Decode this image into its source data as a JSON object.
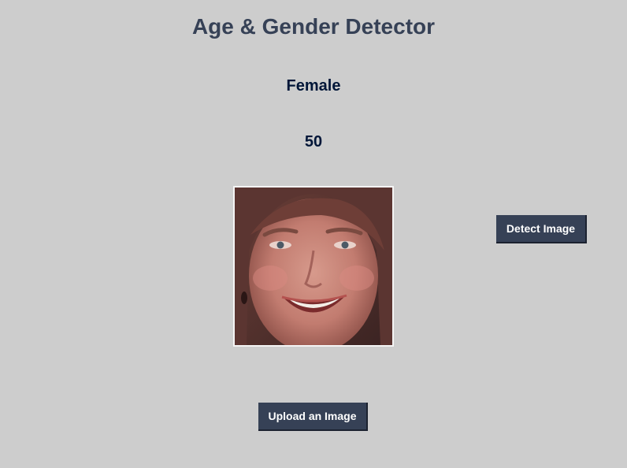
{
  "app": {
    "title": "Age & Gender Detector"
  },
  "result": {
    "gender": "Female",
    "age": "50"
  },
  "image": {
    "subject": "face-photo"
  },
  "buttons": {
    "detect_label": "Detect Image",
    "upload_label": "Upload an Image"
  },
  "colors": {
    "background": "#cdcdcd",
    "title": "#364156",
    "result_text": "#011638",
    "button_bg": "#364156",
    "button_text": "#ffffff"
  }
}
